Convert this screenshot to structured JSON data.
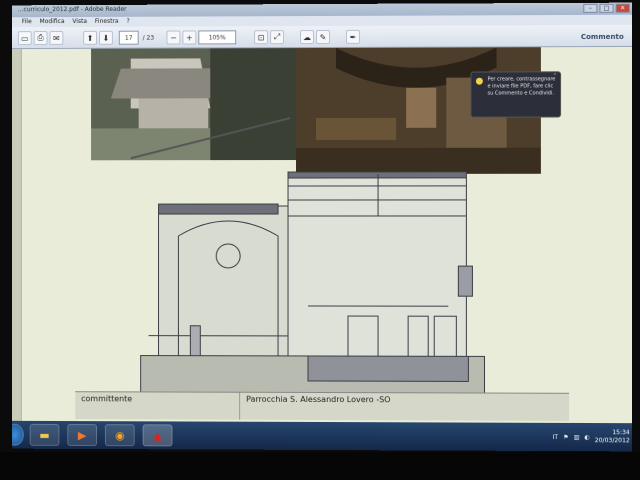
{
  "window": {
    "title": "...curriculo_2012.pdf - Adobe Reader"
  },
  "menu": {
    "items": [
      "File",
      "Modifica",
      "Vista",
      "Finestra",
      "?"
    ]
  },
  "toolbar": {
    "page_current": "17",
    "page_total": "/ 23",
    "zoom": "105%",
    "comment_label": "Commento"
  },
  "tooltip": {
    "text": "Per creare, contrassegnare e inviare file PDF, fare clic su Commento e Condividi."
  },
  "table": {
    "label": "committente",
    "value": "Parrocchia S. Alessandro Lovero -SO"
  },
  "taskbar": {
    "apps": [
      "explorer-folder-icon",
      "media-player-icon",
      "office-outlook-icon",
      "adobe-reader-icon"
    ]
  },
  "tray": {
    "language": "IT",
    "time": "15:34",
    "date": "20/03/2012"
  }
}
